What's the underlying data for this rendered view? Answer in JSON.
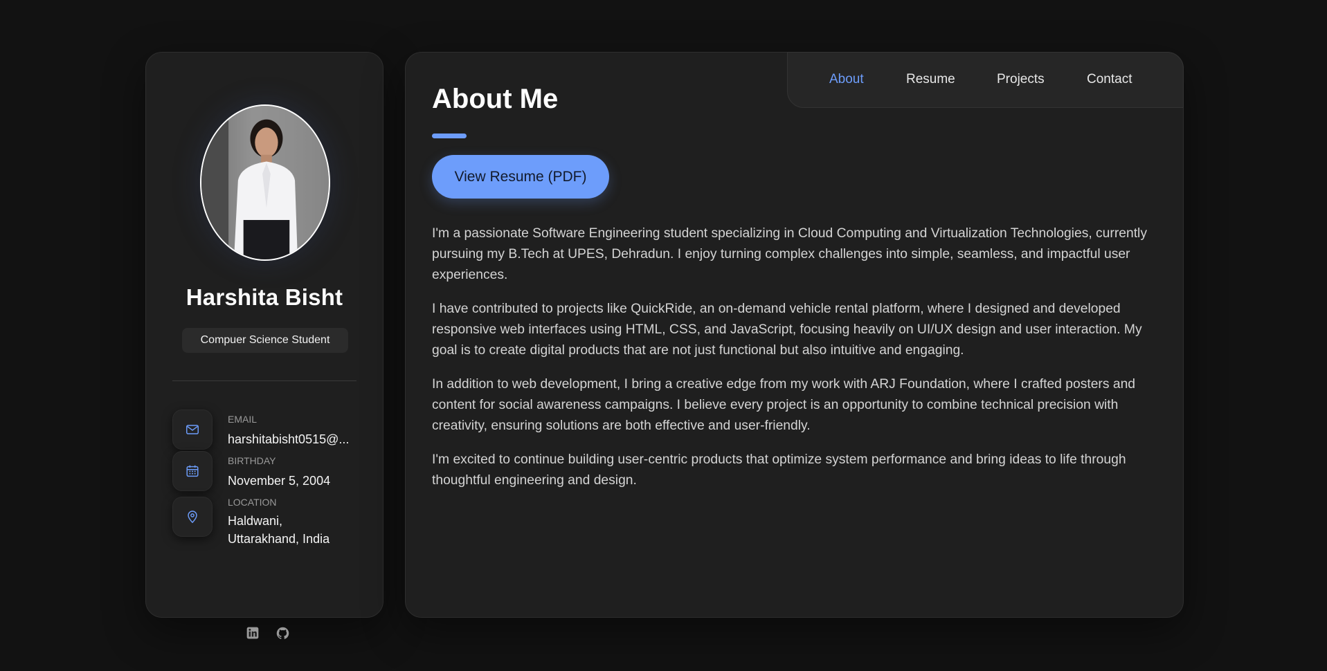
{
  "profile": {
    "name": "Harshita Bisht",
    "role": "Compuer Science Student"
  },
  "contacts": [
    {
      "label": "EMAIL",
      "value": "harshitabisht0515@...",
      "icon": "mail-icon"
    },
    {
      "label": "BIRTHDAY",
      "value": "November 5, 2004",
      "icon": "calendar-icon"
    },
    {
      "label": "LOCATION",
      "value": "Haldwani, Uttarakhand, India",
      "icon": "location-pin-icon"
    }
  ],
  "socials": [
    {
      "name": "linkedin-icon"
    },
    {
      "name": "github-icon"
    }
  ],
  "nav": {
    "items": [
      "About",
      "Resume",
      "Projects",
      "Contact"
    ],
    "active": "About"
  },
  "about": {
    "title": "About Me",
    "resume_button": "View Resume (PDF)",
    "paragraphs": [
      "I'm a passionate Software Engineering student specializing in Cloud Computing and Virtualization Technologies, currently pursuing my B.Tech at UPES, Dehradun. I enjoy turning complex challenges into simple, seamless, and impactful user experiences.",
      "I have contributed to projects like QuickRide, an on-demand vehicle rental platform, where I designed and developed responsive web interfaces using HTML, CSS, and JavaScript, focusing heavily on UI/UX design and user interaction. My goal is to create digital products that are not just functional but also intuitive and engaging.",
      "In addition to web development, I bring a creative edge from my work with ARJ Foundation, where I crafted posters and content for social awareness campaigns. I believe every project is an opportunity to combine technical precision with creativity, ensuring solutions are both effective and user-friendly.",
      "I'm excited to continue building user-centric products that optimize system performance and bring ideas to life through thoughtful engineering and design."
    ]
  },
  "colors": {
    "accent": "#6d9dfb",
    "background": "#121212",
    "card": "#1f1f1f"
  }
}
